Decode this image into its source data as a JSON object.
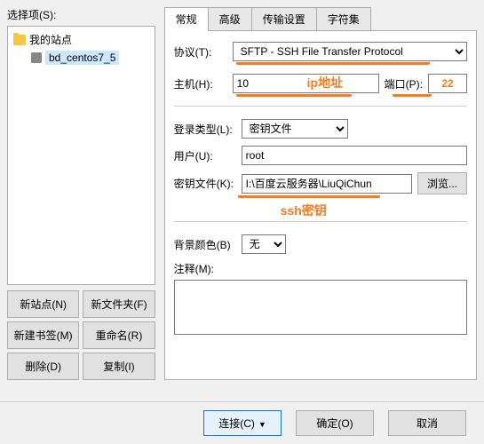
{
  "leftPanel": {
    "selectLabel": "选择项(S):",
    "rootLabel": "我的站点",
    "siteName": "bd_centos7_5",
    "buttons": {
      "newSite": "新站点(N)",
      "newFolder": "新文件夹(F)",
      "newBookmark": "新建书签(M)",
      "rename": "重命名(R)",
      "delete": "删除(D)",
      "copy": "复制(I)"
    }
  },
  "tabs": {
    "general": "常规",
    "advanced": "高级",
    "transfer": "传输设置",
    "charset": "字符集"
  },
  "form": {
    "protocolLabel": "协议(T):",
    "protocolValue": "SFTP - SSH File Transfer Protocol",
    "hostLabel": "主机(H):",
    "hostValue": "10",
    "portLabel": "端口(P):",
    "portValue": "22",
    "loginTypeLabel": "登录类型(L):",
    "loginTypeValue": "密钥文件",
    "userLabel": "用户(U):",
    "userValue": "root",
    "keyFileLabel": "密钥文件(K):",
    "keyFileValue": "I:\\百度云服务器\\LiuQiChun",
    "browseBtn": "浏览...",
    "bgColorLabel": "背景颜色(B)",
    "bgColorValue": "无",
    "commentLabel": "注释(M):"
  },
  "annotations": {
    "ipLabel": "ip地址",
    "sshLabel": "ssh密钥"
  },
  "bottomButtons": {
    "connect": "连接(C)",
    "ok": "确定(O)",
    "cancel": "取消"
  }
}
